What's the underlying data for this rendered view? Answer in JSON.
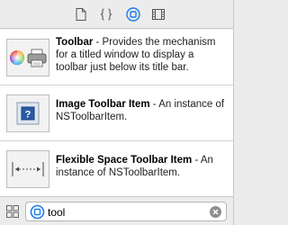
{
  "inspector": {
    "tabs": [
      {
        "icon": "file-icon",
        "selected": false
      },
      {
        "icon": "code-braces-icon",
        "selected": false
      },
      {
        "icon": "object-library-icon",
        "selected": true
      },
      {
        "icon": "media-library-icon",
        "selected": false
      }
    ],
    "accent_color": "#1a7cf5"
  },
  "library": {
    "items": [
      {
        "title": "Toolbar",
        "description": "Provides the mechanism for a titled window to display a toolbar just below its title bar.",
        "icon": "toolbar-icon"
      },
      {
        "title": "Image Toolbar Item",
        "description": "An instance of NSToolbarItem.",
        "icon": "image-toolbar-item-icon"
      },
      {
        "title": "Flexible Space Toolbar Item",
        "description": "An instance of NSToolbarItem.",
        "icon": "flexible-space-icon"
      }
    ]
  },
  "filter": {
    "value": "tool",
    "view_mode_icon": "grid-view-icon",
    "clear_icon": "clear-icon"
  }
}
